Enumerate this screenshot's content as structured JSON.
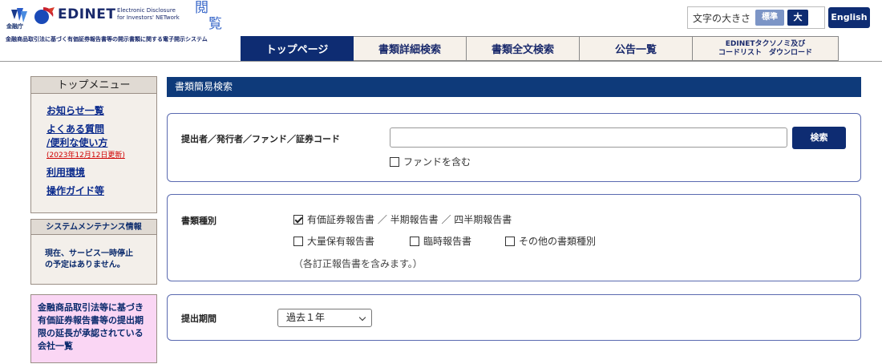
{
  "header": {
    "fsa_label": "金融庁",
    "brand": "EDINET",
    "brand_sub_line1": "Electronic Disclosure",
    "brand_sub_line2": "for Investors' NETwork",
    "etsuran_1": "閲",
    "etsuran_2": "覧",
    "tagline": "金融商品取引法に基づく有価証券報告書等の開示書類に関する電子開示システム",
    "font_size_label": "文字の大きさ",
    "font_size_standard": "標準",
    "font_size_large": "大",
    "english_button": "English"
  },
  "nav": {
    "tabs": [
      {
        "label": "トップページ"
      },
      {
        "label": "書類詳細検索"
      },
      {
        "label": "書類全文検索"
      },
      {
        "label": "公告一覧"
      },
      {
        "label_line1": "EDINETタクソノミ及び",
        "label_line2": "コードリスト　ダウンロード"
      }
    ]
  },
  "sidebar": {
    "menu_title": "トップメニュー",
    "links": {
      "news": "お知らせ一覧",
      "faq_line1": "よくある質問",
      "faq_line2": "/便利な使い方",
      "faq_note": "(2023年12月12日更新)",
      "environment": "利用環境",
      "guide": "操作ガイド等"
    },
    "maintenance_title": "システムメンテナンス情報",
    "maintenance_line1": "現在、サービス一時停止",
    "maintenance_line2": "の予定はありません。",
    "extension_line1": "金融商品取引法等に基づき",
    "extension_line2": "有価証券報告書等の提出期",
    "extension_line3": "限の延長が承認されている",
    "extension_line4": "会社一覧"
  },
  "main": {
    "section_title": "書類簡易検索",
    "filer_label": "提出者／発行者／ファンド／証券コード",
    "search_value": "",
    "search_button": "検索",
    "include_fund": "ファンドを含む",
    "doc_type_label": "書類種別",
    "doc_types": {
      "annual": "有価証券報告書 ／ 半期報告書 ／ 四半期報告書",
      "large_holding": "大量保有報告書",
      "extraordinary": "臨時報告書",
      "other": "その他の書類種別"
    },
    "doc_type_note": "（各訂正報告書を含みます。）",
    "period_label": "提出期間",
    "period_value": "過去１年"
  },
  "colors": {
    "navy": "#0e2c72",
    "header_bar": "#0e3a7a",
    "link": "#0a2a8c",
    "alert": "#d00000",
    "pink_box": "#fad6f4"
  }
}
